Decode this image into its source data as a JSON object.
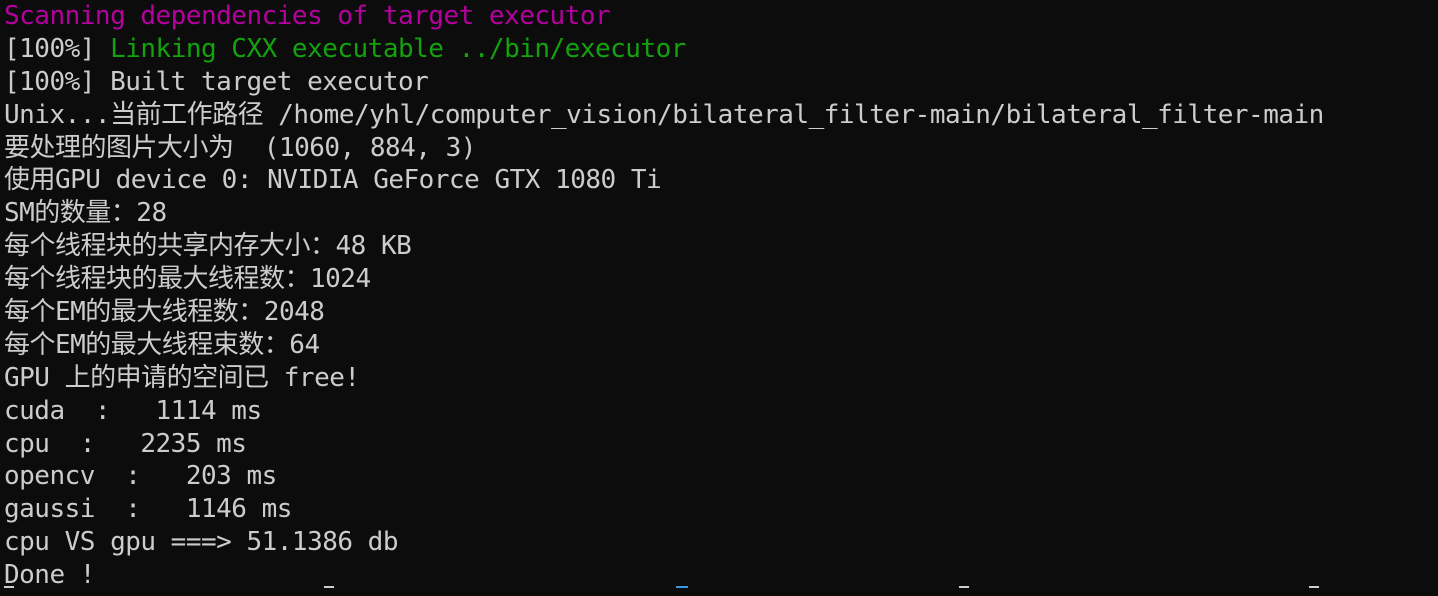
{
  "terminal": {
    "background": "#0c0c0c",
    "foreground": "#cccccc",
    "colors": {
      "magenta": "#b4009e",
      "green": "#13a10e"
    },
    "lines": {
      "l0": "Scanning dependencies of target executor",
      "l1_prefix": "[100%] ",
      "l1_text": "Linking CXX executable ../bin/executor",
      "l2": "[100%] Built target executor",
      "l3": "Unix...当前工作路径 /home/yhl/computer_vision/bilateral_filter-main/bilateral_filter-main",
      "l4": "要处理的图片大小为  (1060, 884, 3)",
      "l5": "使用GPU device 0: NVIDIA GeForce GTX 1080 Ti",
      "l6": "SM的数量：28",
      "l7": "每个线程块的共享内存大小：48 KB",
      "l8": "每个线程块的最大线程数：1024",
      "l9": "每个EM的最大线程数：2048",
      "l10": "每个EM的最大线程束数：64",
      "l11": "GPU 上的申请的空间已 free!",
      "l12": "cuda  :   1114 ms",
      "l13": "cpu  :   2235 ms",
      "l14": "opencv  :   203 ms",
      "l15": "gaussi  :   1146 ms",
      "l16": "cpu VS gpu ===> 51.1386 db",
      "l17": "Done !"
    }
  }
}
